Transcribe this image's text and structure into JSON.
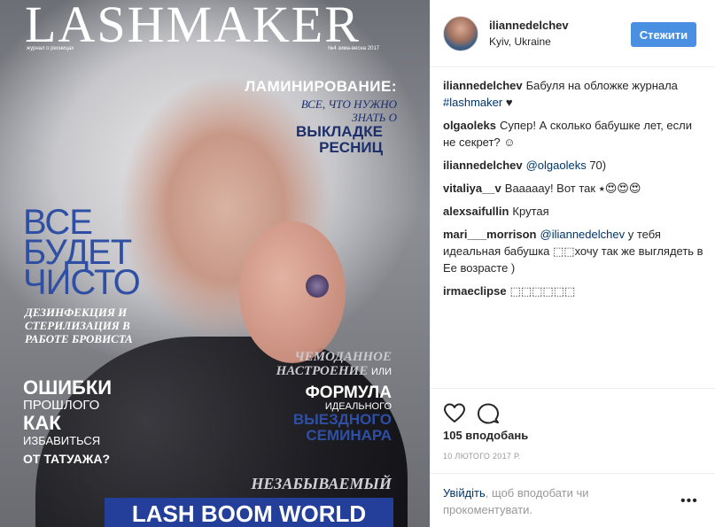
{
  "cover": {
    "title": "LASHMAKER",
    "subtitle": "журнал о ресницах",
    "issue": "№4 зима-весна 2017",
    "laminirovanie": "ЛАМИНИРОВАНИЕ:",
    "vse_chto": "ВСЕ, ЧТО НУЖНО ЗНАТЬ О",
    "vykladke": "ВЫКЛАДКЕ РЕСНИЦ",
    "vse_budet": "ВСЕ БУДЕТ ЧИСТО",
    "dezinf": "ДЕЗИНФЕКЦИЯ И СТЕРИЛИЗАЦИЯ В РАБОТЕ БРОВИСТА",
    "oshibki": "ОШИБКИ",
    "proshlogo": "ПРОШЛОГО",
    "kak": "КАК",
    "izbavitsya": "ИЗБАВИТЬСЯ",
    "ot": "ОТ",
    "tatuazha": "ТАТУАЖА?",
    "chemodannoe": "ЧЕМОДАННОЕ НАСТРОЕНИЕ",
    "ili": "ИЛИ",
    "formula": "ФОРМУЛА",
    "idealnogo": "ИДЕАЛЬНОГО",
    "vyezdnogo": "ВЫЕЗДНОГО СЕМИНАРА",
    "nezabyvaemyi": "НЕЗАБЫВАЕМЫЙ",
    "lashboom": "LASH BOOM WORLD"
  },
  "header": {
    "username": "iliannedelchev",
    "location": "Kyiv, Ukraine",
    "follow_label": "Стежити"
  },
  "comments": [
    {
      "user": "iliannedelchev",
      "text": "Бабуля на обложке журнала ",
      "link": "#lashmaker",
      "suffix": " ♥"
    },
    {
      "user": "olgaoleks",
      "text": "Супер! А сколько бабушке лет, если не секрет? ☺",
      "link": "",
      "suffix": ""
    },
    {
      "user": "iliannedelchev",
      "text": "",
      "link": "@olgaoleks",
      "suffix": " 70)"
    },
    {
      "user": "vitaliya__v",
      "text": "Вааааау! Вот так ⭑😍😍😍",
      "link": "",
      "suffix": ""
    },
    {
      "user": "alexsaifullin",
      "text": "Крутая",
      "link": "",
      "suffix": ""
    },
    {
      "user": "mari___morrison",
      "text": "",
      "link": "@iliannedelchev",
      "suffix": " у тебя идеальная бабушка ⬚⬚хочу так же выглядеть в Ее возрасте )"
    },
    {
      "user": "irmaeclipse",
      "text": "⬚⬚⬚⬚⬚⬚",
      "link": "",
      "suffix": ""
    }
  ],
  "actions": {
    "likes": "105 вподобань",
    "date": "10 ЛЮТОГО 2017 Р.",
    "login_link": "Увійдіть",
    "login_text": ", щоб вподобати чи прокоментувати.",
    "more": "•••"
  },
  "icons": {
    "heart": "heart-icon",
    "comment": "comment-icon",
    "more": "more-options-icon"
  },
  "colors": {
    "follow_button": "#4a90e2",
    "link": "#003569",
    "cover_blue": "#2e4fa3"
  }
}
